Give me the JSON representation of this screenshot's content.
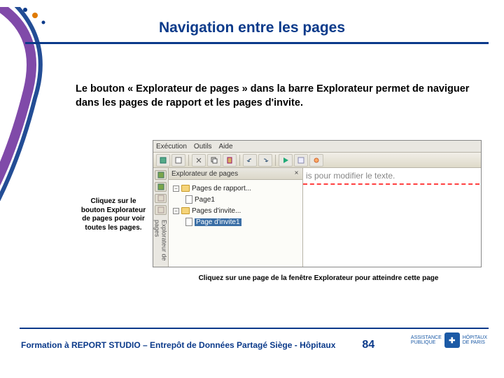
{
  "title": "Navigation entre les pages",
  "body_text": "Le bouton « Explorateur de pages » dans la barre Explorateur permet de naviguer dans les pages de rapport et les pages d'invite.",
  "callout_left": "Cliquez sur le bouton Explorateur de pages pour voir toutes les pages.",
  "callout_bottom": "Cliquez sur une page de la fenêtre Explorateur pour atteindre cette page",
  "screenshot": {
    "menu": {
      "execution": "Exécution",
      "outils": "Outils",
      "aide": "Aide"
    },
    "panel_title": "Explorateur de pages",
    "vertical_tab_label": "Explorateur de pages",
    "tree": {
      "reports_group": "Pages de rapport...",
      "page1": "Page1",
      "prompts_group": "Pages d'invite...",
      "prompt_page1": "Page d'invite1"
    },
    "canvas_hint": "is pour modifier le texte."
  },
  "footer": {
    "text": "Formation à REPORT STUDIO – Entrepôt de Données Partagé Siège - Hôpitaux",
    "page_number": "84",
    "logo_lines": {
      "l1": "ASSISTANCE",
      "l2": "PUBLIQUE",
      "l3": "HÔPITAUX",
      "l4": "DE PARIS"
    }
  }
}
